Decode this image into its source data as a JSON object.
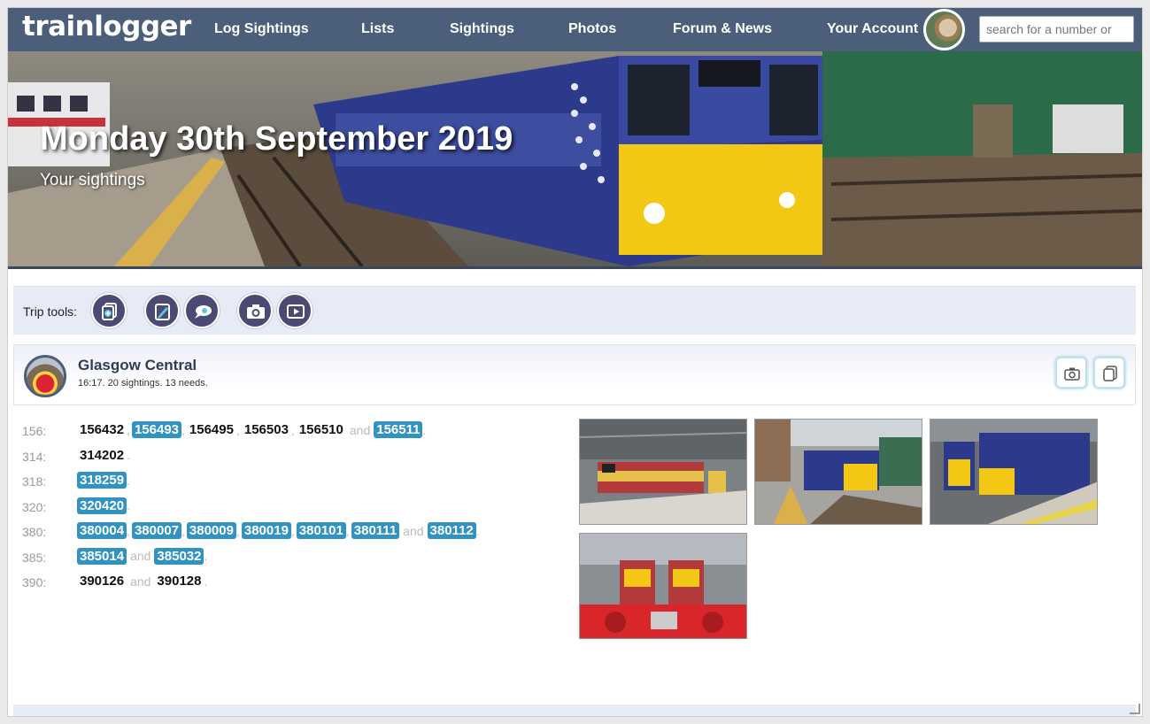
{
  "nav": {
    "logo": "trainlogger",
    "links": [
      "Log Sightings",
      "Lists",
      "Sightings",
      "Photos",
      "Forum & News",
      "Your Account"
    ],
    "search_placeholder": "search for a number or"
  },
  "hero": {
    "title": "Monday 30th September 2019",
    "subtitle": "Your sightings"
  },
  "trip_tools": {
    "label": "Trip tools:",
    "buttons": [
      "add-sighting-icon",
      "edit-icon",
      "comment-icon",
      "camera-icon",
      "play-icon"
    ]
  },
  "location": {
    "name": "Glasgow Central",
    "meta": "16:17. 20 sightings. 13 needs."
  },
  "sightings": [
    {
      "class": "156:",
      "units": [
        {
          "number": "156432",
          "need": false
        },
        {
          "number": "156493",
          "need": true
        },
        {
          "number": "156495",
          "need": false
        },
        {
          "number": "156503",
          "need": false
        },
        {
          "number": "156510",
          "need": false
        },
        {
          "number": "156511",
          "need": true
        }
      ]
    },
    {
      "class": "314:",
      "units": [
        {
          "number": "314202",
          "need": false
        }
      ]
    },
    {
      "class": "318:",
      "units": [
        {
          "number": "318259",
          "need": true
        }
      ]
    },
    {
      "class": "320:",
      "units": [
        {
          "number": "320420",
          "need": true
        }
      ]
    },
    {
      "class": "380:",
      "units": [
        {
          "number": "380004",
          "need": true
        },
        {
          "number": "380007",
          "need": true
        },
        {
          "number": "380009",
          "need": true
        },
        {
          "number": "380019",
          "need": true
        },
        {
          "number": "380101",
          "need": true
        },
        {
          "number": "380111",
          "need": true
        },
        {
          "number": "380112",
          "need": true
        }
      ]
    },
    {
      "class": "385:",
      "units": [
        {
          "number": "385014",
          "need": true
        },
        {
          "number": "385032",
          "need": true
        }
      ]
    },
    {
      "class": "390:",
      "units": [
        {
          "number": "390126",
          "need": false
        },
        {
          "number": "390128",
          "need": false
        }
      ]
    }
  ],
  "separators": {
    "comma": ",",
    "and": "and",
    "end": "."
  },
  "colors": {
    "nav": "#4b5f7a",
    "need_badge": "#3293c2",
    "tool_button": "#4a4a75"
  }
}
